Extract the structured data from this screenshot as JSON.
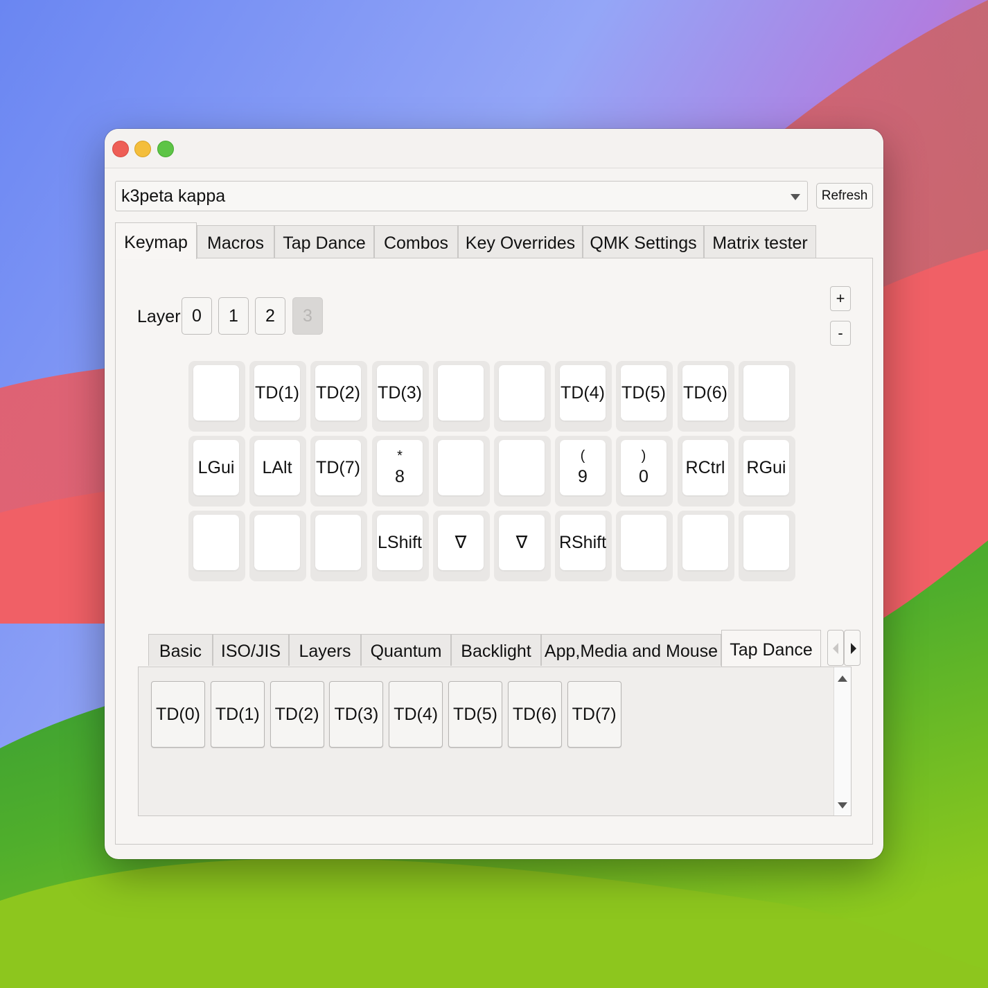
{
  "window": {
    "traffic_lights": [
      "close",
      "minimize",
      "zoom"
    ]
  },
  "keyboard_select": {
    "value": "k3peta kappa",
    "icon": "chevron-down-icon"
  },
  "refresh": {
    "label": "Refresh"
  },
  "main_tabs": [
    {
      "label": "Keymap",
      "active": true
    },
    {
      "label": "Macros"
    },
    {
      "label": "Tap Dance"
    },
    {
      "label": "Combos"
    },
    {
      "label": "Key Overrides"
    },
    {
      "label": "QMK Settings"
    },
    {
      "label": "Matrix tester"
    }
  ],
  "layer": {
    "label": "Layer",
    "buttons": [
      "0",
      "1",
      "2",
      "3"
    ],
    "disabled_index": 3,
    "add_label": "+",
    "remove_label": "-"
  },
  "keys": [
    [
      [
        "",
        ""
      ],
      [
        "TD(1)",
        ""
      ],
      [
        "TD(2)",
        ""
      ],
      [
        "TD(3)",
        ""
      ],
      [
        "",
        ""
      ],
      [
        "",
        ""
      ],
      [
        "TD(4)",
        ""
      ],
      [
        "TD(5)",
        ""
      ],
      [
        "TD(6)",
        ""
      ],
      [
        "",
        ""
      ]
    ],
    [
      [
        "LGui",
        ""
      ],
      [
        "LAlt",
        ""
      ],
      [
        "TD(7)",
        ""
      ],
      [
        "*",
        "8"
      ],
      [
        "",
        ""
      ],
      [
        "",
        ""
      ],
      [
        "(",
        "9"
      ],
      [
        ")",
        "0"
      ],
      [
        "RCtrl",
        ""
      ],
      [
        "RGui",
        ""
      ]
    ],
    [
      [
        "",
        ""
      ],
      [
        "",
        ""
      ],
      [
        "",
        ""
      ],
      [
        "LShift",
        ""
      ],
      [
        "∇",
        ""
      ],
      [
        "∇",
        ""
      ],
      [
        "RShift",
        ""
      ],
      [
        "",
        ""
      ],
      [
        "",
        ""
      ],
      [
        "",
        ""
      ]
    ]
  ],
  "sub_tabs": [
    {
      "label": "Basic"
    },
    {
      "label": "ISO/JIS"
    },
    {
      "label": "Layers"
    },
    {
      "label": "Quantum"
    },
    {
      "label": "Backlight"
    },
    {
      "label": "App,Media and Mouse"
    },
    {
      "label": "Tap Dance",
      "active": true
    }
  ],
  "tap_dance_keys": [
    "TD(0)",
    "TD(1)",
    "TD(2)",
    "TD(3)",
    "TD(4)",
    "TD(5)",
    "TD(6)",
    "TD(7)"
  ]
}
